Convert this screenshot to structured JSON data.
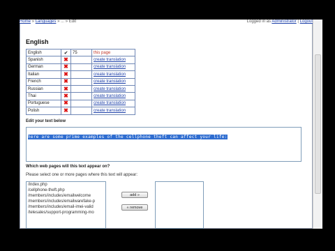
{
  "topbar": {
    "crumb_home": "Home",
    "crumb_sep1": "»",
    "crumb_page": "Languages",
    "crumb_rest": "» ... » Edit",
    "right_text": "Logged in as",
    "right_link1": "Administrator",
    "right_link2": "Logout"
  },
  "section_title": "English",
  "languages": [
    {
      "name": "English",
      "status": "check",
      "count": "75",
      "action": "this page"
    },
    {
      "name": "Spanish",
      "status": "x",
      "count": "",
      "action": "create translation"
    },
    {
      "name": "German",
      "status": "x",
      "count": "",
      "action": "create translation"
    },
    {
      "name": "Italian",
      "status": "x",
      "count": "",
      "action": "create translation"
    },
    {
      "name": "French",
      "status": "x",
      "count": "",
      "action": "create translation"
    },
    {
      "name": "Russian",
      "status": "x",
      "count": "",
      "action": "create translation"
    },
    {
      "name": "Thai",
      "status": "x",
      "count": "",
      "action": "create translation"
    },
    {
      "name": "Portuguese",
      "status": "x",
      "count": "",
      "action": "create translation"
    },
    {
      "name": "Polish",
      "status": "x",
      "count": "",
      "action": "create translation"
    }
  ],
  "edit_label": "Edit your text below",
  "edit_text": "here are some prime examples of the cellphone theft can affect your life:",
  "pages_label": "Which web pages will this text appear on?",
  "pages_hint": "Please select one or more pages where this text will appear:",
  "available_pages": [
    "/index.php",
    "/cellphone-theft.php",
    "/members/includes/emailwelcome",
    "/members/includes/emailwarefake-p",
    "/members/includes/email-imei-valid",
    "/telesales/support-programming-mo"
  ],
  "add_button": "add »",
  "remove_button": "« remove",
  "colors": {
    "accent": "#1a3ea8",
    "error": "#d11111",
    "selection": "#2f6dd0"
  }
}
